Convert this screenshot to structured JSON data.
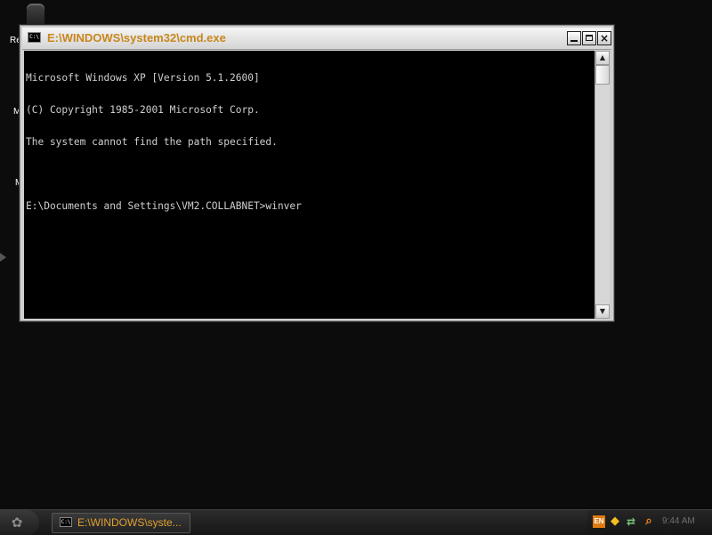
{
  "window": {
    "title": "E:\\WINDOWS\\system32\\cmd.exe",
    "icon_text": "C:\\",
    "controls": {
      "minimize": "minimize",
      "maximize": "maximize",
      "close": "×"
    }
  },
  "console": {
    "lines": [
      "Microsoft Windows XP [Version 5.1.2600]",
      "(C) Copyright 1985-2001 Microsoft Corp.",
      "The system cannot find the path specified.",
      "",
      "E:\\Documents and Settings\\VM2.COLLABNET>winver"
    ]
  },
  "scrollbar": {
    "up_glyph": "▲",
    "down_glyph": "▼"
  },
  "taskbar": {
    "start_glyph": "✿",
    "tasks": [
      {
        "label": "E:\\WINDOWS\\syste...",
        "icon_text": "C:\\"
      }
    ],
    "tray": {
      "language": "EN",
      "shield_glyph": "◆",
      "network_glyph": "⇄",
      "search_glyph": "⌕",
      "clock": "9:44 AM"
    }
  },
  "desktop": {
    "icon_labels": [
      "Re",
      "M",
      "M"
    ]
  },
  "colors": {
    "title_text": "#c8871d",
    "task_text": "#e0a030",
    "console_bg": "#000000",
    "console_fg": "#cfcfcf",
    "desktop_bg": "#0c0c0c"
  },
  "icons": [
    "recycle-bin-icon",
    "cmd-icon",
    "start-orb-icon",
    "shield-icon",
    "network-icon",
    "search-icon"
  ]
}
